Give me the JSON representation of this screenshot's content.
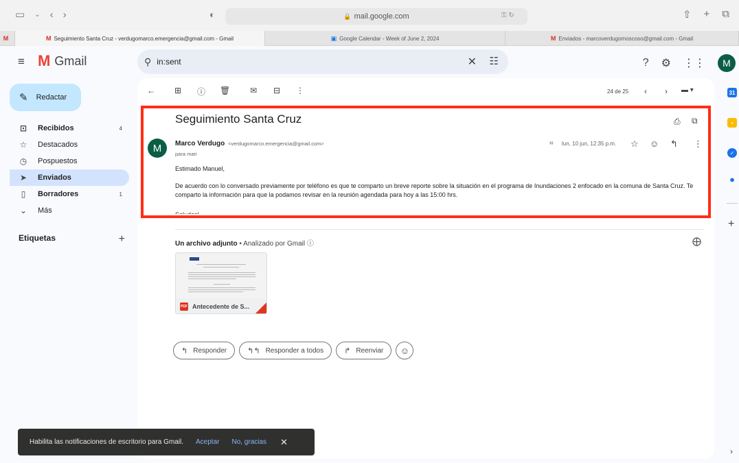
{
  "browser": {
    "url": "mail.google.com",
    "tabs": [
      {
        "label": "Seguimiento Santa Cruz - verdugomarco.emergencia@gmail.com - Gmail",
        "active": true,
        "icon": "gmail-icon"
      },
      {
        "label": "Google Calendar - Week of June 2, 2024",
        "active": false,
        "icon": "calendar-icon"
      },
      {
        "label": "Enviados - marcoverdugomoscoso@gmail.com - Gmail",
        "active": false,
        "icon": "gmail-icon"
      }
    ]
  },
  "header": {
    "app_name": "Gmail",
    "search_value": "in:sent",
    "avatar_initial": "M"
  },
  "sidebar": {
    "compose_label": "Redactar",
    "items": [
      {
        "label": "Recibidos",
        "icon": "inbox-icon",
        "count": "4",
        "bold": true
      },
      {
        "label": "Destacados",
        "icon": "star-icon",
        "count": "",
        "bold": false
      },
      {
        "label": "Pospuestos",
        "icon": "clock-icon",
        "count": "",
        "bold": false
      },
      {
        "label": "Enviados",
        "icon": "send-icon",
        "count": "",
        "bold": true,
        "active": true
      },
      {
        "label": "Borradores",
        "icon": "draft-icon",
        "count": "1",
        "bold": true
      },
      {
        "label": "Más",
        "icon": "chevron-down-icon",
        "count": "",
        "bold": false
      }
    ],
    "labels_heading": "Etiquetas"
  },
  "toolbar": {
    "count_text": "24 de 25"
  },
  "message": {
    "subject": "Seguimiento Santa Cruz",
    "sender_name": "Marco Verdugo",
    "sender_email": "<verdugomarco.emergencia@gmail.com>",
    "to_line": "para mari",
    "date": "lun, 10 jun, 12:35 p.m.",
    "greeting": "Estimado Manuel,",
    "paragraph": "De acuerdo con lo conversado previamente por teléfono es que te comparto un breve reporte sobre la situación en el programa de Inundaciones 2 enfocado en la comuna de Santa Cruz. Te comparto la información para que la podamos revisar en la reunión agendada para hoy a las 15:00 hrs.",
    "cutoff_text": "Saludos!",
    "sender_avatar_initial": "M"
  },
  "attachments": {
    "heading_bold": "Un archivo adjunto",
    "heading_separator": " • ",
    "heading_rest": "Analizado por Gmail ⓘ",
    "file_name": "Antecedente de S...",
    "file_type": "PDF"
  },
  "actions": {
    "reply": "Responder",
    "reply_all": "Responder a todos",
    "forward": "Reenviar"
  },
  "snackbar": {
    "text": "Habilita las notificaciones de escritorio para Gmail.",
    "accept": "Aceptar",
    "decline": "No, gracias"
  },
  "colors": {
    "highlight_border": "#ff2d16",
    "active_nav": "#d3e3fd",
    "compose_bg": "#c2e7ff",
    "avatar": "#0b5e46"
  }
}
